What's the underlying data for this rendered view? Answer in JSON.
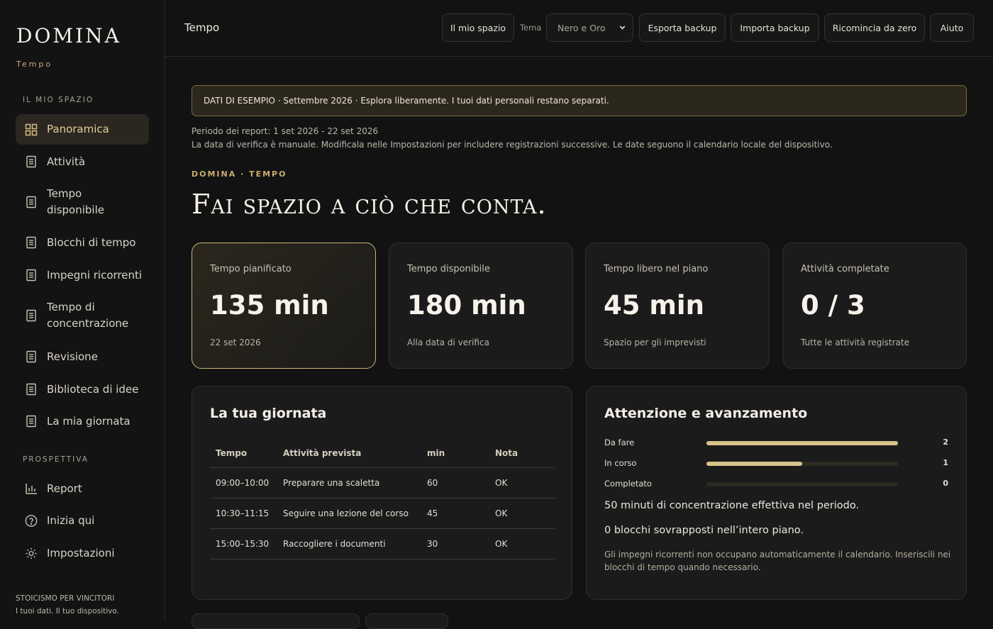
{
  "brand": {
    "name": "DOMINA",
    "subtitle": "Tempo"
  },
  "sidebar": {
    "section1": "IL MIO SPAZIO",
    "items": [
      {
        "label": "Panoramica",
        "icon": "grid-icon",
        "active": true
      },
      {
        "label": "Attività",
        "icon": "document-icon"
      },
      {
        "label": "Tempo disponibile",
        "icon": "document-icon"
      },
      {
        "label": "Blocchi di tempo",
        "icon": "document-icon"
      },
      {
        "label": "Impegni ricorrenti",
        "icon": "document-icon"
      },
      {
        "label": "Tempo di concentrazione",
        "icon": "document-icon"
      },
      {
        "label": "Revisione",
        "icon": "document-icon"
      },
      {
        "label": "Biblioteca di idee",
        "icon": "document-icon"
      },
      {
        "label": "La mia giornata",
        "icon": "document-icon"
      }
    ],
    "section2": "PROSPETTIVA",
    "items2": [
      {
        "label": "Report",
        "icon": "bar-chart-icon"
      },
      {
        "label": "Inizia qui",
        "icon": "help-circle-icon"
      },
      {
        "label": "Impostazioni",
        "icon": "sun-gear-icon"
      }
    ],
    "footer1": "STOICISMO PER VINCITORI",
    "footer2": "I tuoi dati. Il tuo dispositivo."
  },
  "topbar": {
    "title": "Tempo",
    "my_space": "Il mio spazio",
    "theme_label": "Tema",
    "theme_value": "Nero e Oro",
    "export": "Esporta backup",
    "import": "Importa backup",
    "restart": "Ricomincia da zero",
    "help": "Aiuto"
  },
  "banner": "DATI DI ESEMPIO · Settembre 2026 · Esplora liberamente. I tuoi dati personali restano separati.",
  "period": {
    "line1": "Periodo dei report: 1 set 2026 - 22 set 2026",
    "line2": "La data di verifica è manuale. Modificala nelle Impostazioni per includere registrazioni successive. Le date seguono il calendario locale del dispositivo."
  },
  "kicker": "DOMINA · TEMPO",
  "hero": "Fai spazio a ciò che conta.",
  "stats": [
    {
      "label": "Tempo pianificato",
      "value": "135 min",
      "sub": "22 set 2026"
    },
    {
      "label": "Tempo disponibile",
      "value": "180 min",
      "sub": "Alla data di verifica"
    },
    {
      "label": "Tempo libero nel piano",
      "value": "45 min",
      "sub": "Spazio per gli imprevisti"
    },
    {
      "label": "Attività completate",
      "value": "0 / 3",
      "sub": "Tutte le attività registrate"
    }
  ],
  "day": {
    "title": "La tua giornata",
    "headers": [
      "Tempo",
      "Attività prevista",
      "min",
      "Nota"
    ],
    "rows": [
      [
        "09:00–10:00",
        "Preparare una scaletta",
        "60",
        "OK"
      ],
      [
        "10:30–11:15",
        "Seguire una lezione del corso",
        "45",
        "OK"
      ],
      [
        "15:00–15:30",
        "Raccogliere i documenti",
        "30",
        "OK"
      ]
    ]
  },
  "attention": {
    "title": "Attenzione e avanzamento",
    "bars": [
      {
        "label": "Da fare",
        "count": "2",
        "fraction": 1.0
      },
      {
        "label": "In corso",
        "count": "1",
        "fraction": 0.5
      },
      {
        "label": "Completato",
        "count": "0",
        "fraction": 0.0
      }
    ],
    "line1": "50 minuti di concentrazione effettiva nel periodo.",
    "line2": "0 blocchi sovrapposti nell’intero piano.",
    "note": "Gli impegni ricorrenti non occupano automaticamente il calendario. Inseriscili nei blocchi di tempo quando necessario."
  },
  "colors": {
    "accent": "#cbb37a",
    "background": "#121212",
    "card": "#1b1b1b"
  }
}
